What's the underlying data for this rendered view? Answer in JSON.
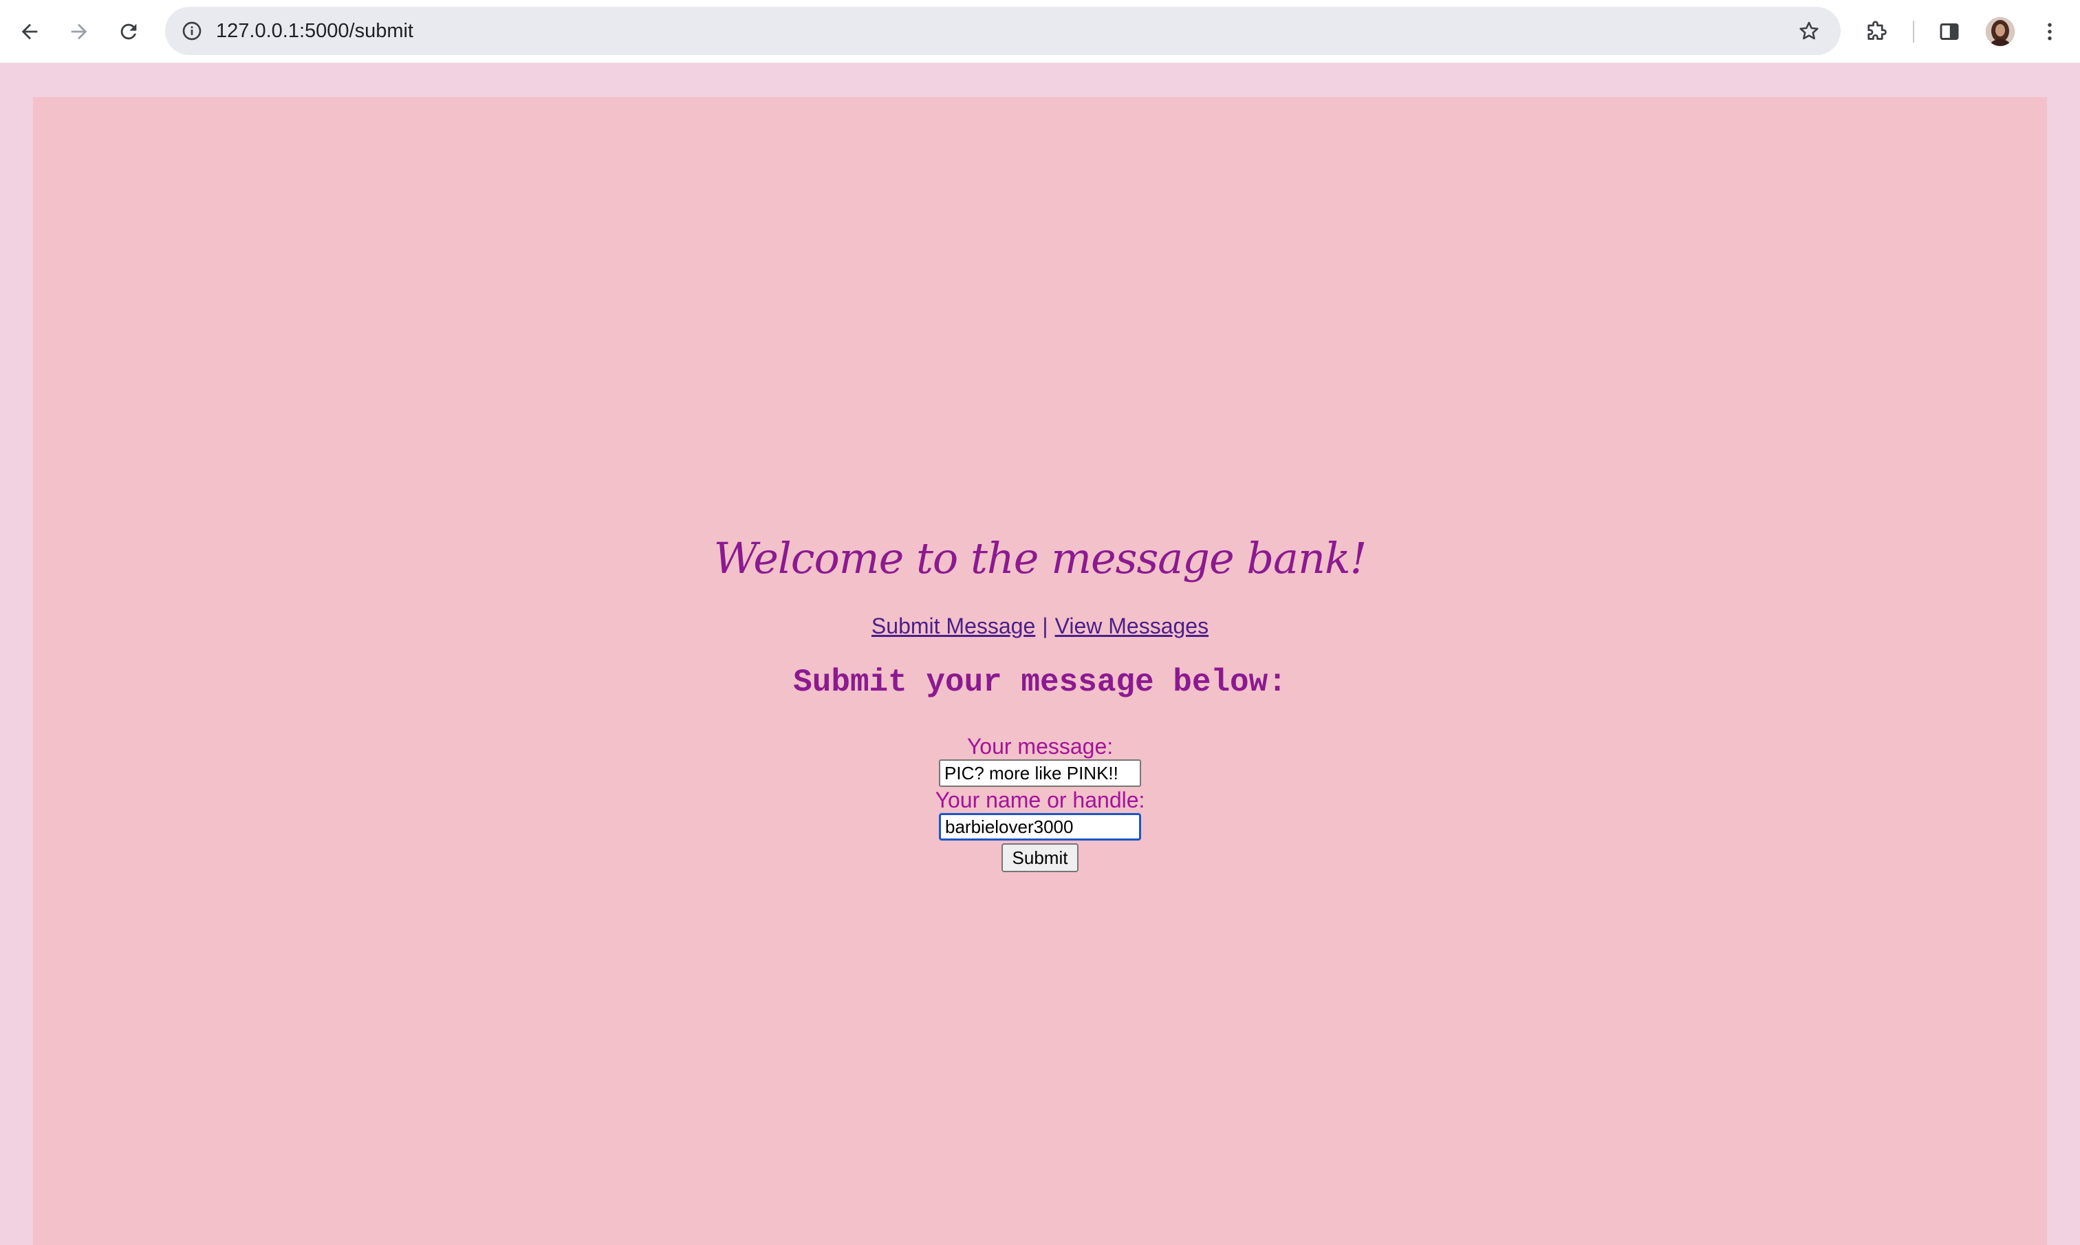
{
  "browser": {
    "url": "127.0.0.1:5000/submit"
  },
  "page": {
    "welcome_title": "Welcome to the message bank!",
    "nav": {
      "submit_link": "Submit Message",
      "separator": "|",
      "view_link": "View Messages"
    },
    "heading": "Submit your message below:",
    "form": {
      "message_label": "Your message:",
      "message_value": "PIC? more like PINK!!",
      "name_label": "Your name or handle:",
      "name_value": "barbielover3000",
      "submit_label": "Submit"
    }
  },
  "colors": {
    "outer_background": "#f2d1e0",
    "page_background": "#f3c1c9",
    "title_color": "#8b1a91",
    "label_color": "#a3139a",
    "link_color": "#4b1e8a",
    "focus_border": "#1a56c8"
  },
  "icons": {
    "back": "arrow-left-icon",
    "forward": "arrow-right-icon",
    "reload": "reload-icon",
    "site_info": "info-icon",
    "bookmark": "star-icon",
    "extensions": "puzzle-icon",
    "side_panel": "side-panel-icon",
    "menu": "kebab-menu-icon"
  }
}
